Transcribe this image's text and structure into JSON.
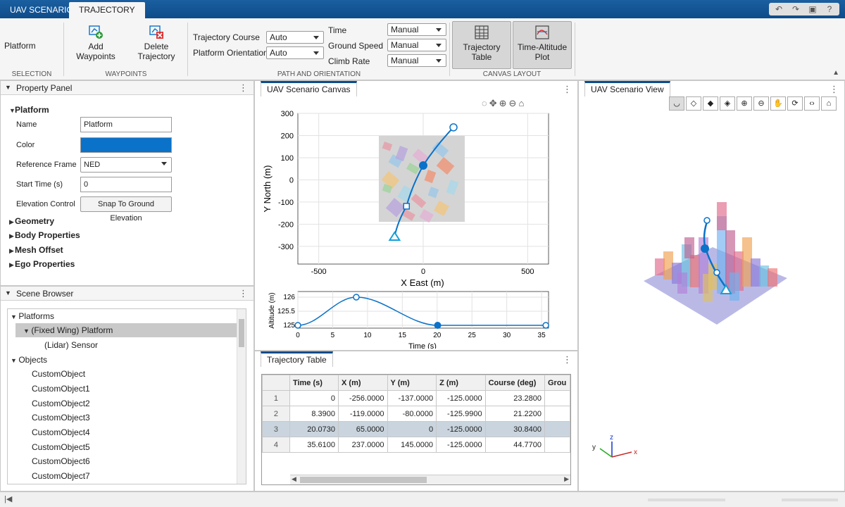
{
  "app_tabs": [
    {
      "label": "UAV SCENARIO",
      "active": false
    },
    {
      "label": "TRAJECTORY",
      "active": true
    }
  ],
  "toolstrip": {
    "selection": {
      "value": "Platform",
      "section_label": "SELECTION"
    },
    "waypoints": {
      "add_label_1": "Add",
      "add_label_2": "Waypoints",
      "delete_label_1": "Delete",
      "delete_label_2": "Trajectory",
      "section_label": "WAYPOINTS"
    },
    "path_orientation": {
      "trajectory_course_label": "Trajectory Course",
      "trajectory_course_value": "Auto",
      "platform_orientation_label": "Platform Orientation",
      "platform_orientation_value": "Auto",
      "time_label": "Time",
      "time_value": "Manual",
      "ground_speed_label": "Ground Speed",
      "ground_speed_value": "Manual",
      "climb_rate_label": "Climb Rate",
      "climb_rate_value": "Manual",
      "section_label": "PATH AND ORIENTATION"
    },
    "canvas_layout": {
      "table_label_1": "Trajectory",
      "table_label_2": "Table",
      "plot_label_1": "Time-Altitude",
      "plot_label_2": "Plot",
      "section_label": "CANVAS LAYOUT"
    }
  },
  "property_panel": {
    "title": "Property Panel",
    "group": "Platform",
    "fields": {
      "name_label": "Name",
      "name_value": "Platform",
      "color_label": "Color",
      "color_hex": "#0a72c8",
      "frame_label": "Reference Frame",
      "frame_value": "NED",
      "start_label": "Start Time (s)",
      "start_value": "0",
      "elev_label": "Elevation Control",
      "elev_button": "Snap To Ground Elevation"
    },
    "collapsed_groups": [
      "Geometry",
      "Body Properties",
      "Mesh Offset",
      "Ego Properties"
    ]
  },
  "scene_browser": {
    "title": "Scene Browser",
    "platforms_label": "Platforms",
    "platform_item": "(Fixed Wing) Platform",
    "sensor_item": "(Lidar) Sensor",
    "objects_label": "Objects",
    "objects": [
      "CustomObject",
      "CustomObject1",
      "CustomObject2",
      "CustomObject3",
      "CustomObject4",
      "CustomObject5",
      "CustomObject6",
      "CustomObject7"
    ]
  },
  "canvas": {
    "tab_label": "UAV Scenario Canvas",
    "xy_plot": {
      "xlabel": "X East (m)",
      "ylabel": "Y North (m)",
      "x_ticks": [
        "-500",
        "0",
        "500"
      ],
      "y_ticks": [
        "300",
        "200",
        "100",
        "0",
        "-100",
        "-200",
        "-300"
      ]
    },
    "alt_plot": {
      "xlabel": "Time (s)",
      "ylabel": "Altitude (m)",
      "x_ticks": [
        "0",
        "5",
        "10",
        "15",
        "20",
        "25",
        "30",
        "35"
      ],
      "y_ticks": [
        "126",
        "125.5",
        "125"
      ]
    }
  },
  "chart_data": [
    {
      "type": "line",
      "xlabel": "X East (m)",
      "ylabel": "Y North (m)",
      "xlim": [
        -600,
        600
      ],
      "ylim": [
        -380,
        300
      ],
      "waypoints": [
        {
          "x": -137,
          "y": -256
        },
        {
          "x": -80,
          "y": -119
        },
        {
          "x": 0,
          "y": 65
        },
        {
          "x": 145,
          "y": 237
        }
      ],
      "grid": true
    },
    {
      "type": "line",
      "xlabel": "Time (s)",
      "ylabel": "Altitude (m)",
      "xlim": [
        0,
        36
      ],
      "ylim": [
        124.9,
        126.2
      ],
      "waypoints": [
        {
          "x": 0,
          "y": 125
        },
        {
          "x": 8.39,
          "y": 126
        },
        {
          "x": 20.073,
          "y": 125
        },
        {
          "x": 35.61,
          "y": 125
        }
      ],
      "grid": true
    }
  ],
  "trajectory_table": {
    "tab_label": "Trajectory Table",
    "columns": [
      "Time (s)",
      "X (m)",
      "Y (m)",
      "Z (m)",
      "Course (deg)",
      "Grou"
    ],
    "rows": [
      {
        "idx": "1",
        "cells": [
          "0",
          "-256.0000",
          "-137.0000",
          "-125.0000",
          "23.2800",
          ""
        ]
      },
      {
        "idx": "2",
        "cells": [
          "8.3900",
          "-119.0000",
          "-80.0000",
          "-125.9900",
          "21.2200",
          ""
        ]
      },
      {
        "idx": "3",
        "cells": [
          "20.0730",
          "65.0000",
          "0",
          "-125.0000",
          "30.8400",
          ""
        ]
      },
      {
        "idx": "4",
        "cells": [
          "35.6100",
          "237.0000",
          "145.0000",
          "-125.0000",
          "44.7700",
          ""
        ]
      }
    ],
    "selected_row": 3
  },
  "scenario_view": {
    "tab_label": "UAV Scenario View",
    "axes": {
      "x": "x",
      "y": "y",
      "z": "z"
    }
  },
  "colors": {
    "accent": "#0a72c8",
    "tabstrip": "#0e4c8a"
  }
}
